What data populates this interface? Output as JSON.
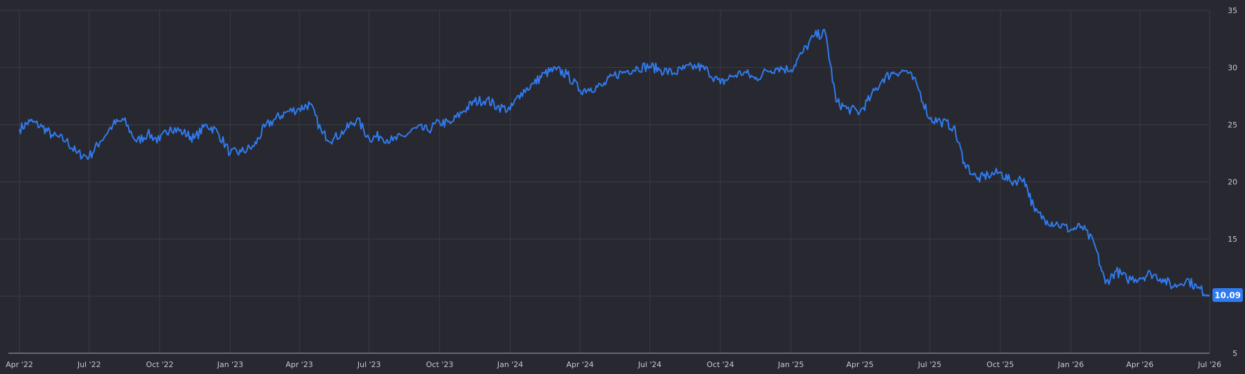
{
  "chart_data": {
    "type": "line",
    "title": "",
    "xlabel": "",
    "ylabel": "",
    "ylim": [
      5,
      35
    ],
    "xlim": [
      "2022-04-01",
      "2026-07-01"
    ],
    "y_ticks": [
      5,
      10,
      15,
      20,
      25,
      30,
      35
    ],
    "x_ticks": [
      {
        "date": "2022-04-01",
        "label": "Apr '22"
      },
      {
        "date": "2022-07-01",
        "label": "Jul '22"
      },
      {
        "date": "2022-10-01",
        "label": "Oct '22"
      },
      {
        "date": "2023-01-01",
        "label": "Jan '23"
      },
      {
        "date": "2023-04-01",
        "label": "Apr '23"
      },
      {
        "date": "2023-07-01",
        "label": "Jul '23"
      },
      {
        "date": "2023-10-01",
        "label": "Oct '23"
      },
      {
        "date": "2024-01-01",
        "label": "Jan '24"
      },
      {
        "date": "2024-04-01",
        "label": "Apr '24"
      },
      {
        "date": "2024-07-01",
        "label": "Jul '24"
      },
      {
        "date": "2024-10-01",
        "label": "Oct '24"
      },
      {
        "date": "2025-01-01",
        "label": "Jan '25"
      },
      {
        "date": "2025-04-01",
        "label": "Apr '25"
      },
      {
        "date": "2025-07-01",
        "label": "Jul '25"
      },
      {
        "date": "2025-10-01",
        "label": "Oct '25"
      },
      {
        "date": "2026-01-01",
        "label": "Jan '26"
      },
      {
        "date": "2026-04-01",
        "label": "Apr '26"
      },
      {
        "date": "2026-07-01",
        "label": "Jul '26"
      }
    ],
    "grid": true,
    "line_color": "#2f7bf0",
    "background_color": "#282830",
    "last_value_label": "10.09",
    "series": [
      {
        "x": [
          "2022-04-01",
          "2022-04-15",
          "2022-05-01",
          "2022-05-15",
          "2022-06-01",
          "2022-06-15",
          "2022-07-01",
          "2022-07-15",
          "2022-08-01",
          "2022-08-15",
          "2022-09-01",
          "2022-09-15",
          "2022-10-01",
          "2022-10-15",
          "2022-11-01",
          "2022-11-15",
          "2022-12-01",
          "2022-12-15",
          "2023-01-01",
          "2023-01-15",
          "2023-02-01",
          "2023-02-15",
          "2023-03-01",
          "2023-03-15",
          "2023-04-01",
          "2023-04-15",
          "2023-05-01",
          "2023-05-15",
          "2023-06-01",
          "2023-06-15",
          "2023-07-01",
          "2023-07-15",
          "2023-08-01",
          "2023-08-15",
          "2023-09-01",
          "2023-09-15",
          "2023-10-01",
          "2023-10-15",
          "2023-11-01",
          "2023-11-15",
          "2023-12-01",
          "2023-12-15",
          "2024-01-01",
          "2024-01-15",
          "2024-02-01",
          "2024-02-15",
          "2024-03-01",
          "2024-03-15",
          "2024-04-01",
          "2024-04-15",
          "2024-05-01",
          "2024-05-15",
          "2024-06-01",
          "2024-06-15",
          "2024-07-01",
          "2024-07-15",
          "2024-08-01",
          "2024-08-15",
          "2024-09-01",
          "2024-09-15",
          "2024-10-01",
          "2024-10-15",
          "2024-11-01",
          "2024-11-15",
          "2024-12-01",
          "2024-12-15",
          "2025-01-01",
          "2025-01-15",
          "2025-02-01",
          "2025-02-15",
          "2025-03-01",
          "2025-03-15",
          "2025-04-01",
          "2025-04-15",
          "2025-05-01",
          "2025-05-15",
          "2025-06-01",
          "2025-06-15",
          "2025-07-01",
          "2025-07-15",
          "2025-08-01",
          "2025-08-15",
          "2025-09-01",
          "2025-09-15",
          "2025-10-01",
          "2025-10-15",
          "2025-11-01",
          "2025-11-15",
          "2025-12-01",
          "2025-12-15",
          "2026-01-01",
          "2026-01-15",
          "2026-02-01",
          "2026-02-15",
          "2026-03-01",
          "2026-03-15",
          "2026-04-01",
          "2026-04-15",
          "2026-05-01",
          "2026-05-15",
          "2026-06-01",
          "2026-06-15",
          "2026-07-01"
        ],
        "values": [
          24.6,
          25.3,
          24.8,
          24.0,
          23.6,
          22.5,
          22.2,
          23.5,
          25.0,
          25.4,
          23.5,
          24.2,
          23.6,
          24.8,
          24.3,
          23.8,
          25.0,
          24.4,
          22.5,
          22.6,
          23.1,
          24.8,
          25.5,
          26.1,
          26.4,
          26.8,
          24.2,
          23.7,
          24.6,
          25.5,
          23.8,
          24.0,
          23.6,
          24.0,
          24.7,
          24.5,
          25.2,
          25.1,
          26.2,
          27.0,
          27.2,
          26.6,
          26.3,
          27.8,
          28.6,
          29.5,
          29.8,
          29.4,
          28.0,
          28.2,
          28.4,
          29.3,
          29.7,
          30.0,
          30.1,
          29.8,
          29.5,
          29.9,
          30.1,
          29.7,
          28.6,
          29.2,
          29.6,
          29.0,
          29.7,
          30.0,
          29.8,
          31.2,
          32.8,
          33.0,
          27.0,
          26.4,
          26.1,
          27.4,
          29.0,
          29.6,
          29.7,
          28.4,
          25.5,
          25.3,
          24.8,
          21.7,
          20.2,
          20.6,
          20.8,
          20.0,
          20.3,
          17.4,
          16.6,
          16.3,
          15.8,
          16.1,
          14.5,
          11.1,
          12.2,
          11.5,
          11.6,
          12.0,
          11.5,
          10.8,
          11.5,
          10.7,
          10.09
        ]
      }
    ]
  }
}
